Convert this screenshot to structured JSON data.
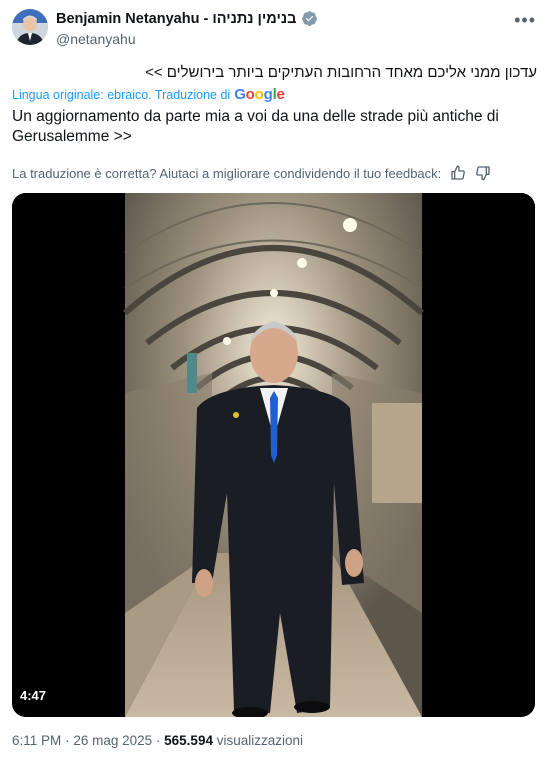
{
  "author": {
    "display_name": "Benjamin Netanyahu - בנימין נתניהו",
    "handle": "@netanyahu",
    "verified_icon": "verified-badge-icon"
  },
  "menu": {
    "more_label": "•••"
  },
  "tweet": {
    "original_text": "עדכון ממני אליכם מאחד הרחובות העתיקים ביותר בירושלים >>",
    "translation_label": "Lingua originale: ebraico. Traduzione di",
    "translation_provider": [
      "G",
      "o",
      "o",
      "g",
      "l",
      "e"
    ],
    "translated_text": "Un aggiornamento da parte mia a voi da una delle strade più antiche di Gerusalemme >>",
    "feedback_prompt": "La traduzione è corretta? Aiutaci a migliorare condividendo il tuo feedback:"
  },
  "video": {
    "duration": "4:47"
  },
  "meta": {
    "time": "6:11 PM",
    "separator": "·",
    "date": "26 mag 2025",
    "views_count": "565.594",
    "views_label": "visualizzazioni"
  },
  "colors": {
    "link_blue": "#1d9bf0",
    "text_primary": "#0f1419",
    "text_secondary": "#536471"
  }
}
